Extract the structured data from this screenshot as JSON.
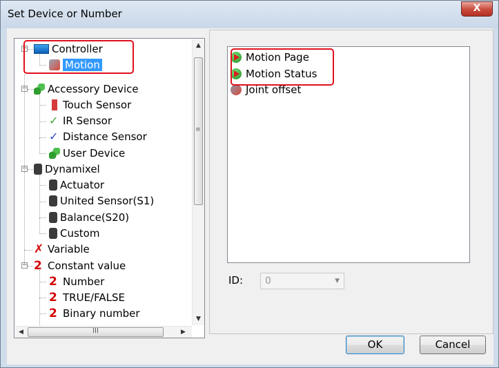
{
  "window": {
    "title": "Set Device or Number",
    "close_label": "X"
  },
  "tree": {
    "items": [
      {
        "label": "Controller",
        "icon": "controller-icon"
      },
      {
        "label": "Motion",
        "icon": "motion-icon"
      },
      {
        "label": "Accessory Device",
        "icon": "accessory-device-icon"
      },
      {
        "label": "Touch Sensor",
        "icon": "touch-sensor-icon"
      },
      {
        "label": "IR Sensor",
        "icon": "ir-sensor-icon"
      },
      {
        "label": "Distance Sensor",
        "icon": "distance-sensor-icon"
      },
      {
        "label": "User Device",
        "icon": "user-device-icon"
      },
      {
        "label": "Dynamixel",
        "icon": "dynamixel-icon"
      },
      {
        "label": "Actuator",
        "icon": "actuator-icon"
      },
      {
        "label": "United Sensor(S1)",
        "icon": "united-sensor-icon"
      },
      {
        "label": "Balance(S20)",
        "icon": "balance-icon"
      },
      {
        "label": "Custom",
        "icon": "custom-icon"
      },
      {
        "label": "Variable",
        "icon": "variable-icon"
      },
      {
        "label": "Constant value",
        "icon": "constant-value-icon"
      },
      {
        "label": "Number",
        "icon": "number-icon"
      },
      {
        "label": "TRUE/FALSE",
        "icon": "true-false-icon"
      },
      {
        "label": "Binary number",
        "icon": "binary-number-icon"
      }
    ],
    "scroll_grip": "III"
  },
  "list": {
    "items": [
      {
        "label": "Motion Page",
        "icon": "play-icon"
      },
      {
        "label": "Motion Status",
        "icon": "play-icon"
      },
      {
        "label": "Joint offset",
        "icon": "joint-offset-icon"
      }
    ]
  },
  "id_field": {
    "label": "ID:",
    "value": "0"
  },
  "buttons": {
    "ok": "OK",
    "cancel": "Cancel"
  },
  "colors": {
    "selection": "#3399ff",
    "highlight_box": "#e0101c"
  }
}
